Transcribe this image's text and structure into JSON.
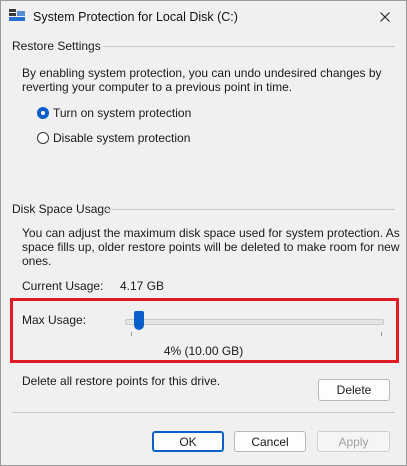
{
  "window": {
    "title": "System Protection for Local Disk (C:)"
  },
  "restore_settings": {
    "label": "Restore Settings",
    "description_line1": "By enabling system protection, you can undo undesired changes by",
    "description_line2": "reverting your computer to a previous point in time.",
    "options": [
      {
        "label": "Turn on system protection",
        "checked": true
      },
      {
        "label": "Disable system protection",
        "checked": false
      }
    ]
  },
  "disk_space": {
    "label": "Disk Space Usage",
    "description_line1": "You can adjust the maximum disk space used for system protection. As",
    "description_line2": "space fills up, older restore points will be deleted to make room for new",
    "description_line3": "ones.",
    "current_usage_label": "Current Usage:",
    "current_usage_value": "4.17 GB",
    "max_usage_label": "Max Usage:",
    "max_usage_percent": 4,
    "max_usage_value": "4% (10.00 GB)"
  },
  "delete_section": {
    "text": "Delete all restore points for this drive.",
    "button": "Delete"
  },
  "footer": {
    "ok": "OK",
    "cancel": "Cancel",
    "apply": "Apply"
  },
  "colors": {
    "accent": "#0a60c8",
    "highlight": "#e01b24"
  }
}
